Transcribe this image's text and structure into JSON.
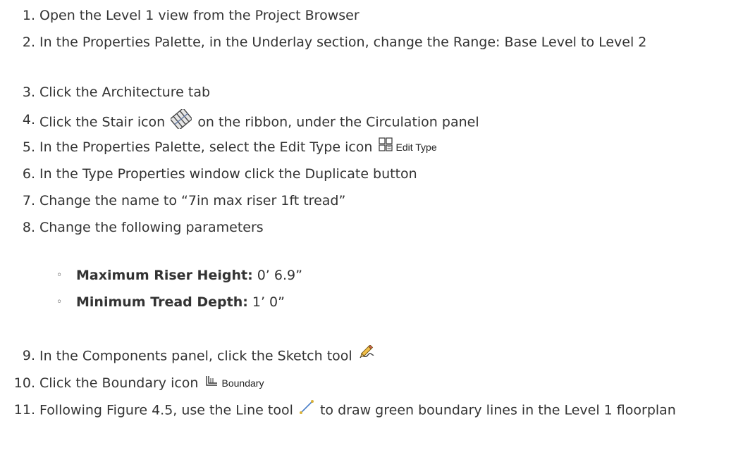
{
  "steps": [
    {
      "num": "1.",
      "text": "Open the Level 1 view from the Project Browser"
    },
    {
      "num": "2.",
      "text": "In the Properties Palette, in the Underlay section, change the Range: Base Level to Level 2"
    },
    {
      "num": "3.",
      "text": "Click the Architecture tab"
    },
    {
      "num": "4.",
      "before": "Click the Stair icon",
      "after": "on the ribbon, under the Circulation panel"
    },
    {
      "num": "5.",
      "before": "In the Properties Palette, select the Edit Type icon",
      "icon_label": "Edit Type"
    },
    {
      "num": "6.",
      "text": "In the Type Properties window click the Duplicate button"
    },
    {
      "num": "7.",
      "text": "Change the name to “7in max riser 1ft tread”"
    },
    {
      "num": "8.",
      "text": "Change the following parameters"
    },
    {
      "num": "9.",
      "before": "In the Components panel, click the Sketch tool"
    },
    {
      "num": "10.",
      "before": "Click the Boundary icon",
      "icon_label": "Boundary"
    },
    {
      "num": "11.",
      "before": "Following Figure 4.5, use the Line tool",
      "after": "to draw green boundary lines in the Level 1 floorplan"
    }
  ],
  "parameters": [
    {
      "bullet": "◦",
      "label": "Maximum Riser Height:",
      "value": "0’ 6.9”"
    },
    {
      "bullet": "◦",
      "label": "Minimum Tread Depth:",
      "value": "1’ 0”"
    }
  ],
  "icons": {
    "stair": "stair-icon",
    "edit_type": "edit-type-icon",
    "sketch": "sketch-pencil-icon",
    "boundary": "boundary-icon",
    "line": "line-tool-icon"
  }
}
